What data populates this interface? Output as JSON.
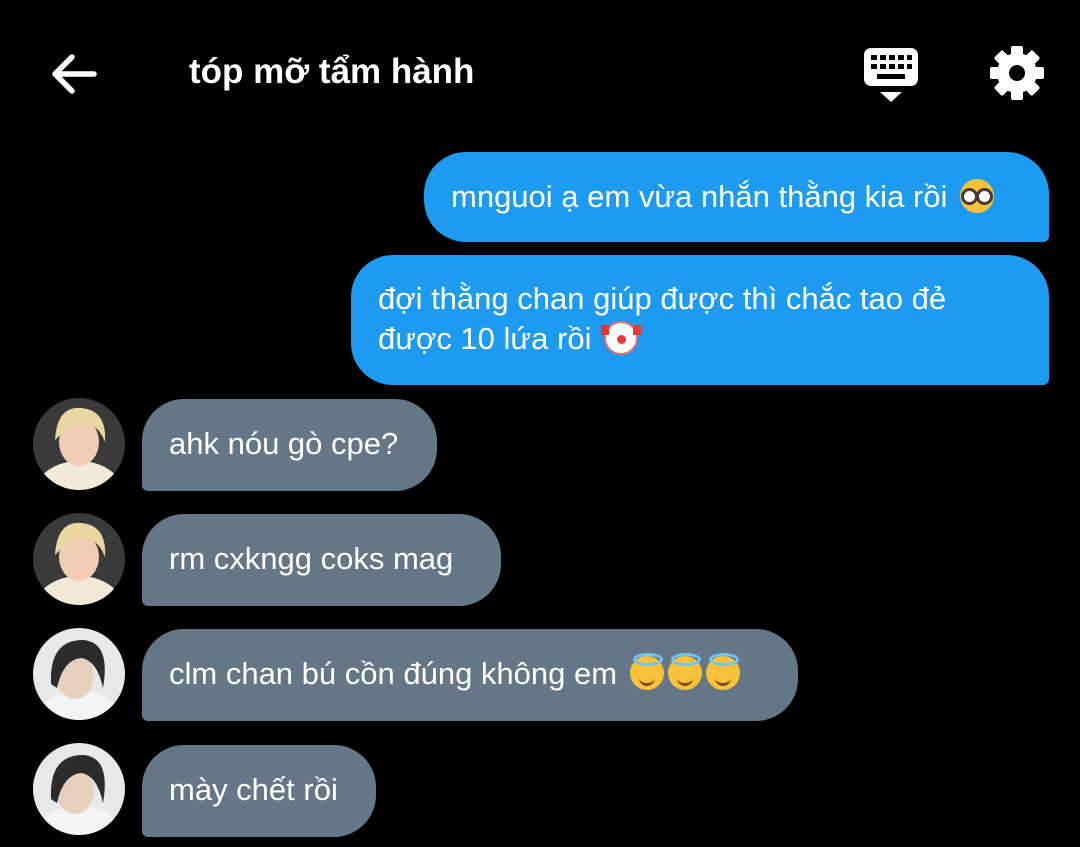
{
  "header": {
    "title": "tóp mỡ tẩm hành",
    "back_icon": "arrow-left-icon",
    "keyboard_icon": "keyboard-icon",
    "settings_icon": "gear-icon"
  },
  "colors": {
    "background": "#000000",
    "outgoing_bubble": "#1d9bf0",
    "incoming_bubble": "#657786",
    "text": "#ffffff"
  },
  "messages": [
    {
      "direction": "outgoing",
      "text": "mnguoi ạ em vừa nhắn thằng kia rồi",
      "emojis": [
        "nerd-face-emoji"
      ]
    },
    {
      "direction": "outgoing",
      "line1": "đợi thằng chan giúp được thì chắc tao đẻ",
      "line2": "được 10 lứa rồi",
      "emojis": [
        "clown-face-emoji"
      ]
    },
    {
      "direction": "incoming",
      "avatar": "avatar-blonde",
      "text": "ahk nóu gò cpe?"
    },
    {
      "direction": "incoming",
      "avatar": "avatar-blonde",
      "text": "rm cxkngg coks mag"
    },
    {
      "direction": "incoming",
      "avatar": "avatar-dark-hair",
      "text": "clm chan bú cồn đúng không em",
      "emojis": [
        "smiling-face-with-halo-emoji",
        "smiling-face-with-halo-emoji",
        "smiling-face-with-halo-emoji"
      ]
    },
    {
      "direction": "incoming",
      "avatar": "avatar-dark-hair",
      "text": "mày chết rồi"
    }
  ]
}
